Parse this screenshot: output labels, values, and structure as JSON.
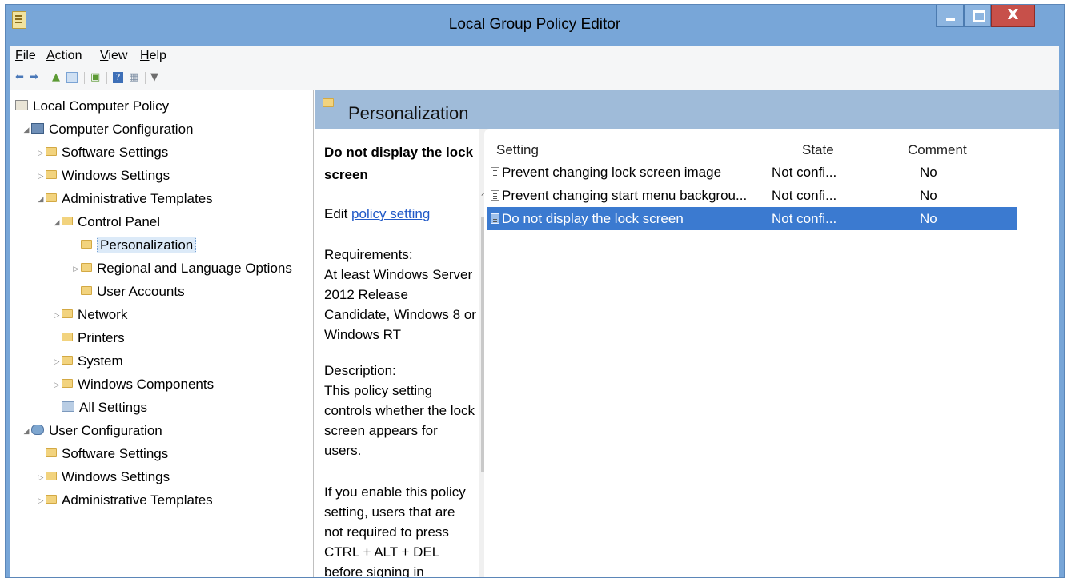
{
  "window": {
    "title": "Local Group Policy Editor"
  },
  "caption_buttons": {
    "minimize": "—",
    "maximize": "□",
    "close": "X"
  },
  "menu": [
    {
      "label": "File"
    },
    {
      "label": "Action"
    },
    {
      "label": "View"
    },
    {
      "label": "Help"
    }
  ],
  "toolbar_icons": [
    "back-icon",
    "forward-icon",
    "up-folder-icon",
    "show-hide-tree-icon",
    "export-list-icon",
    "help-icon",
    "properties-icon",
    "filter-icon"
  ],
  "tree": {
    "root": "Local Computer Policy",
    "items": [
      {
        "label": "Computer Configuration"
      },
      {
        "label": "Software Settings"
      },
      {
        "label": "Windows Settings"
      },
      {
        "label": "Administrative Templates"
      },
      {
        "label": "Control Panel"
      },
      {
        "label": "Personalization"
      },
      {
        "label": "Regional and Language Options"
      },
      {
        "label": "User Accounts"
      },
      {
        "label": "Network"
      },
      {
        "label": "Printers"
      },
      {
        "label": "System"
      },
      {
        "label": "Windows Components"
      },
      {
        "label": "All Settings"
      },
      {
        "label": "User Configuration"
      },
      {
        "label": "Software Settings"
      },
      {
        "label": "Windows Settings"
      },
      {
        "label": "Administrative Templates"
      }
    ]
  },
  "header": {
    "title": "Personalization"
  },
  "description": {
    "title": "Do not display the lock screen",
    "edit_prefix": "Edit ",
    "edit_link": "policy setting ",
    "requirements_label": "Requirements:",
    "requirements": "At least Windows Server 2012 Release Candidate, Windows 8 or Windows RT",
    "description_label": "Description:",
    "description": "This policy setting controls whether the lock screen appears for users.",
    "more": "If you enable this policy setting, users that are not required to press CTRL + ALT + DEL before signing in"
  },
  "table": {
    "columns": [
      "Setting",
      "State",
      "Comment"
    ],
    "rows": [
      {
        "setting": "Prevent changing lock screen image",
        "state": "Not confi...",
        "comment": "No"
      },
      {
        "setting": "Prevent changing start menu backgrou...",
        "state": "Not confi...",
        "comment": "No"
      },
      {
        "setting": "Do not display the lock screen",
        "state": "Not confi...",
        "comment": "No"
      }
    ],
    "selected_index": 2
  },
  "colors": {
    "title_bar": "#78a6d8",
    "selection": "#3b7ad0",
    "header_band": "#9fbbd9",
    "link": "#1f58c7",
    "close_button": "#c7504a"
  }
}
